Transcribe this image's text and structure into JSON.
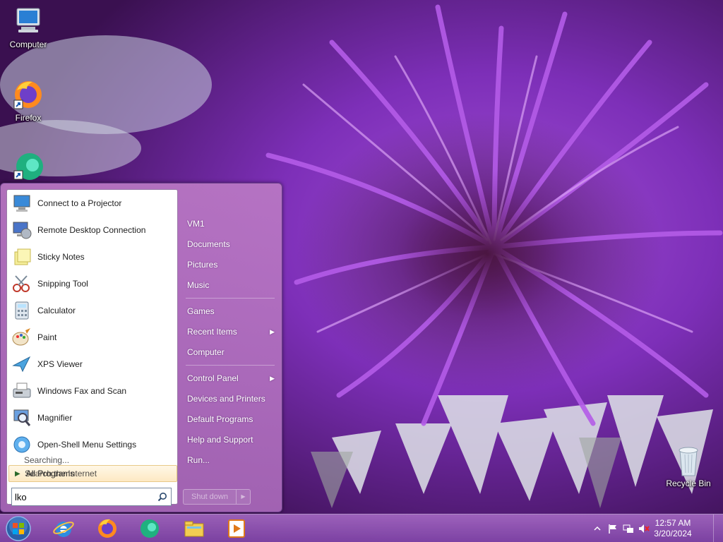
{
  "desktop": {
    "icons": [
      {
        "label": "Computer",
        "icon": "computer-icon"
      },
      {
        "label": "Firefox",
        "icon": "firefox-icon"
      },
      {
        "label": "",
        "icon": "edge-icon"
      },
      {
        "label": "Recycle Bin",
        "icon": "recycle-bin-icon"
      }
    ]
  },
  "start_menu": {
    "programs": [
      {
        "label": "Connect to a Projector",
        "icon": "projector-icon"
      },
      {
        "label": "Remote Desktop Connection",
        "icon": "remote-desktop-icon"
      },
      {
        "label": "Sticky Notes",
        "icon": "sticky-notes-icon"
      },
      {
        "label": "Snipping Tool",
        "icon": "scissors-icon"
      },
      {
        "label": "Calculator",
        "icon": "calculator-icon"
      },
      {
        "label": "Paint",
        "icon": "paint-icon"
      },
      {
        "label": "XPS Viewer",
        "icon": "xps-viewer-icon"
      },
      {
        "label": "Windows Fax and Scan",
        "icon": "fax-icon"
      },
      {
        "label": "Magnifier",
        "icon": "magnifier-icon"
      },
      {
        "label": "Open-Shell Menu Settings",
        "icon": "open-shell-icon"
      }
    ],
    "searching_label": "Searching...",
    "all_programs_label": "All Programs",
    "search_internet_label": "Search the Internet",
    "search": {
      "value": "lko",
      "placeholder": ""
    },
    "right_column": {
      "group1": [
        "VM1",
        "Documents",
        "Pictures",
        "Music"
      ],
      "group2": [
        {
          "label": "Games",
          "submenu": false
        },
        {
          "label": "Recent Items",
          "submenu": true
        },
        {
          "label": "Computer",
          "submenu": false
        }
      ],
      "group3": [
        {
          "label": "Control Panel",
          "submenu": true
        },
        {
          "label": "Devices and Printers",
          "submenu": false
        },
        {
          "label": "Default Programs",
          "submenu": false
        },
        {
          "label": "Help and Support",
          "submenu": false
        },
        {
          "label": "Run...",
          "submenu": false
        }
      ]
    },
    "shutdown_label": "Shut down"
  },
  "taskbar": {
    "pinned": [
      "internet-explorer-icon",
      "firefox-icon",
      "edge-icon",
      "file-explorer-icon",
      "media-player-icon"
    ],
    "tray_icons": [
      "show-hidden-icons-icon",
      "action-center-flag-icon",
      "network-icon",
      "volume-muted-icon"
    ],
    "clock": {
      "time": "12:57 AM",
      "date": "3/20/2024"
    }
  }
}
